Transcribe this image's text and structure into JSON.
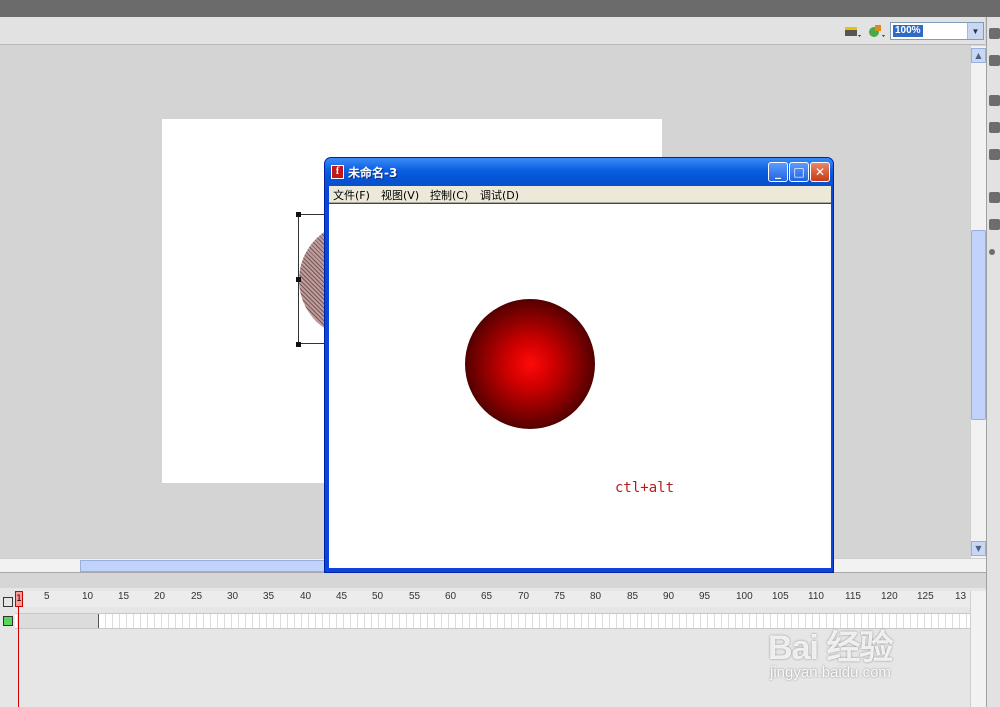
{
  "toolbar": {
    "zoom_value": "100%",
    "icons": [
      "scene-icon",
      "symbol-icon"
    ]
  },
  "preview_window": {
    "title": "未命名-3",
    "app_icon_letter": "f",
    "menu": [
      "文件(F)",
      "视图(V)",
      "控制(C)",
      "调试(D)"
    ],
    "caption": "ctl+alt",
    "colors": {
      "ball_center": "#ff0a0a",
      "ball_edge": "#100000",
      "caption": "#b51d1d",
      "title_bar": "#0a5ee0"
    }
  },
  "timeline": {
    "current_frame": "1",
    "ticks": [
      "5",
      "10",
      "15",
      "20",
      "25",
      "30",
      "35",
      "40",
      "45",
      "50",
      "55",
      "60",
      "65",
      "70",
      "75",
      "80",
      "85",
      "90",
      "95",
      "100",
      "105",
      "110",
      "115",
      "120",
      "125",
      "13"
    ]
  },
  "watermark": {
    "logo": "Bai 经验",
    "url": "jingyan.baidu.com"
  }
}
